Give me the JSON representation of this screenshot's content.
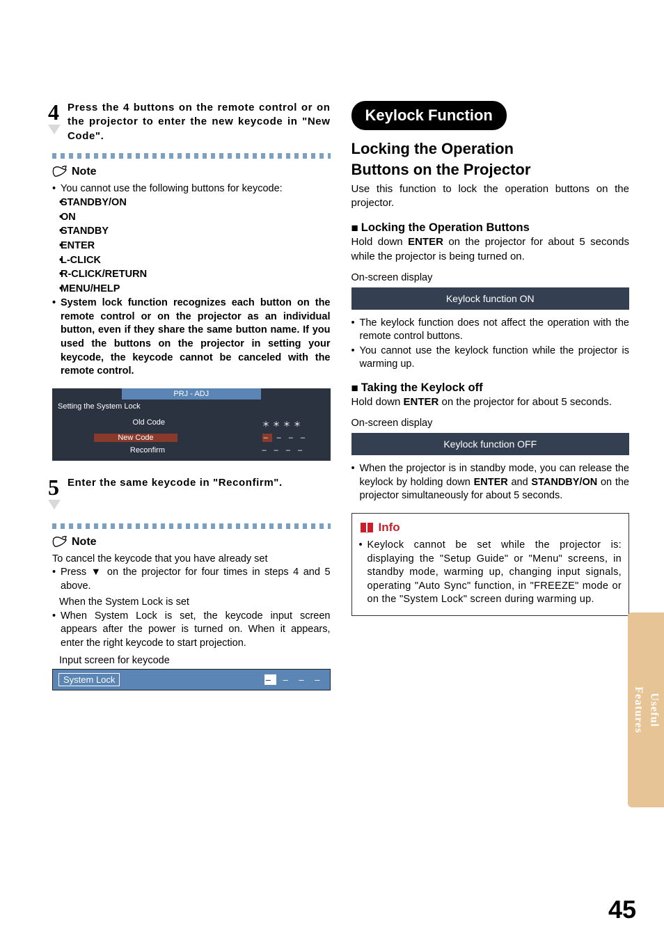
{
  "page_number": "45",
  "side_tab": "Useful\nFeatures",
  "left": {
    "step4": {
      "num": "4",
      "text": "Press the 4 buttons on the remote control or on the projector to enter the new keycode in \"New Code\"."
    },
    "note1": {
      "label": "Note",
      "intro": "You cannot use the following buttons for keycode:",
      "buttons": [
        "STANDBY/ON",
        "ON",
        "STANDBY",
        "ENTER",
        "L-CLICK",
        "R-CLICK/RETURN",
        "MENU/HELP"
      ],
      "para": "System lock function recognizes each button on the remote control or on the projector as an individual button, even if they share the same button name. If you used the buttons on the projector in setting your keycode, the keycode cannot be canceled with the remote control."
    },
    "osd1": {
      "head": "PRJ - ADJ",
      "title": "Setting the System Lock",
      "rows": [
        {
          "label": "Old Code",
          "value": "＊＊＊＊"
        },
        {
          "label": "New Code",
          "value": "– – – –",
          "selected": true
        },
        {
          "label": "Reconfirm",
          "value": "– – – –"
        }
      ]
    },
    "step5": {
      "num": "5",
      "text": "Enter the same keycode in \"Reconfirm\"."
    },
    "note2": {
      "label": "Note",
      "cancel": "To cancel the keycode that you have already set",
      "press_line_a": "Press ",
      "press_line_b": " on the projector for four times in steps 4 and 5 above.",
      "when_set_h": "When the System Lock is set",
      "when_set_p": "When System Lock is set, the keycode input screen appears after the power is turned on. When it appears, enter the right keycode to start projection.",
      "input_caption": "Input screen for keycode"
    },
    "osd2": {
      "label": "System Lock",
      "bars": "– – – –"
    }
  },
  "right": {
    "pill": "Keylock Function",
    "h2a": "Locking the Operation",
    "h2b": "Buttons on the Projector",
    "intro": "Use this function to lock the operation buttons on the projector.",
    "lock_h": "Locking the Operation Buttons",
    "lock_p_a": "Hold down ",
    "lock_p_enter": "ENTER",
    "lock_p_b": " on the projector for about 5 seconds while the projector is being turned on.",
    "osd_caption": "On-screen display",
    "osd_on": "Keylock function ON",
    "lock_notes": [
      "The keylock function does not affect the operation with the remote control buttons.",
      "You cannot use the keylock function while the projector is warming up."
    ],
    "off_h": "Taking the Keylock off",
    "off_p_a": "Hold down ",
    "off_p_enter": "ENTER",
    "off_p_b": " on the projector for about 5 seconds.",
    "osd_off": "Keylock function OFF",
    "standby_note_a": "When the projector is in standby mode, you can release the keylock by holding down ",
    "standby_enter": "ENTER",
    "standby_note_b": " and ",
    "standby_on": "STANDBY/ON",
    "standby_note_c": " on the projector simultaneously for about 5 seconds.",
    "info_label": "Info",
    "info_text": "Keylock cannot be set while the projector is: displaying the \"Setup Guide\" or \"Menu\" screens, in standby mode, warming up, changing input signals, operating \"Auto Sync\" function, in \"FREEZE\" mode or on the \"System Lock\" screen during warming up."
  }
}
